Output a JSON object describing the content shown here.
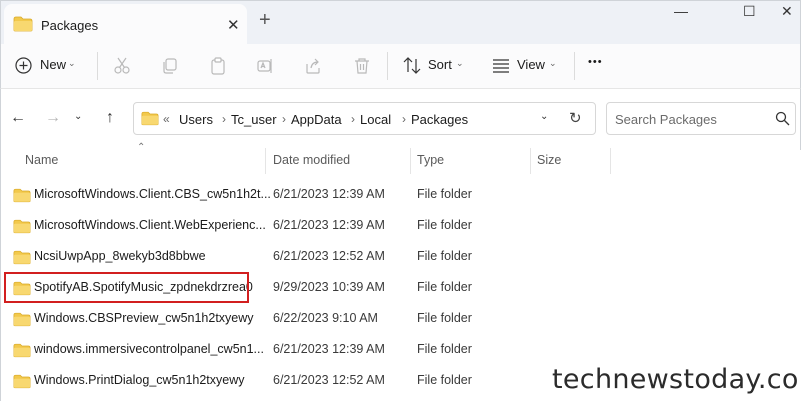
{
  "window": {
    "tab_title": "Packages",
    "tab_close": "✕",
    "new_tab": "+",
    "minimize": "—",
    "maximize": "☐",
    "close": "✕"
  },
  "toolbar": {
    "new_label": "New",
    "sort_label": "Sort",
    "view_label": "View",
    "more_label": "•••"
  },
  "address": {
    "overflow": "«",
    "crumbs": [
      "Users",
      "Tc_user",
      "AppData",
      "Local",
      "Packages"
    ],
    "search_placeholder": "Search Packages"
  },
  "columns": {
    "name": "Name",
    "date_modified": "Date modified",
    "type": "Type",
    "size": "Size"
  },
  "files": [
    {
      "name": "MicrosoftWindows.Client.CBS_cw5n1h2t...",
      "date": "6/21/2023 12:39 AM",
      "type": "File folder"
    },
    {
      "name": "MicrosoftWindows.Client.WebExperienc...",
      "date": "6/21/2023 12:39 AM",
      "type": "File folder"
    },
    {
      "name": "NcsiUwpApp_8wekyb3d8bbwe",
      "date": "6/21/2023 12:52 AM",
      "type": "File folder"
    },
    {
      "name": "SpotifyAB.SpotifyMusic_zpdnekdrzrea0",
      "date": "9/29/2023 10:39 AM",
      "type": "File folder"
    },
    {
      "name": "Windows.CBSPreview_cw5n1h2txyewy",
      "date": "6/22/2023 9:10 AM",
      "type": "File folder"
    },
    {
      "name": "windows.immersivecontrolpanel_cw5n1...",
      "date": "6/21/2023 12:39 AM",
      "type": "File folder"
    },
    {
      "name": "Windows.PrintDialog_cw5n1h2txyewy",
      "date": "6/21/2023 12:52 AM",
      "type": "File folder"
    }
  ],
  "watermark": "technewstoday.com",
  "colors": {
    "folder": "#f2c94c",
    "highlight": "#d21f1f",
    "titlebar": "#eef1f6"
  }
}
